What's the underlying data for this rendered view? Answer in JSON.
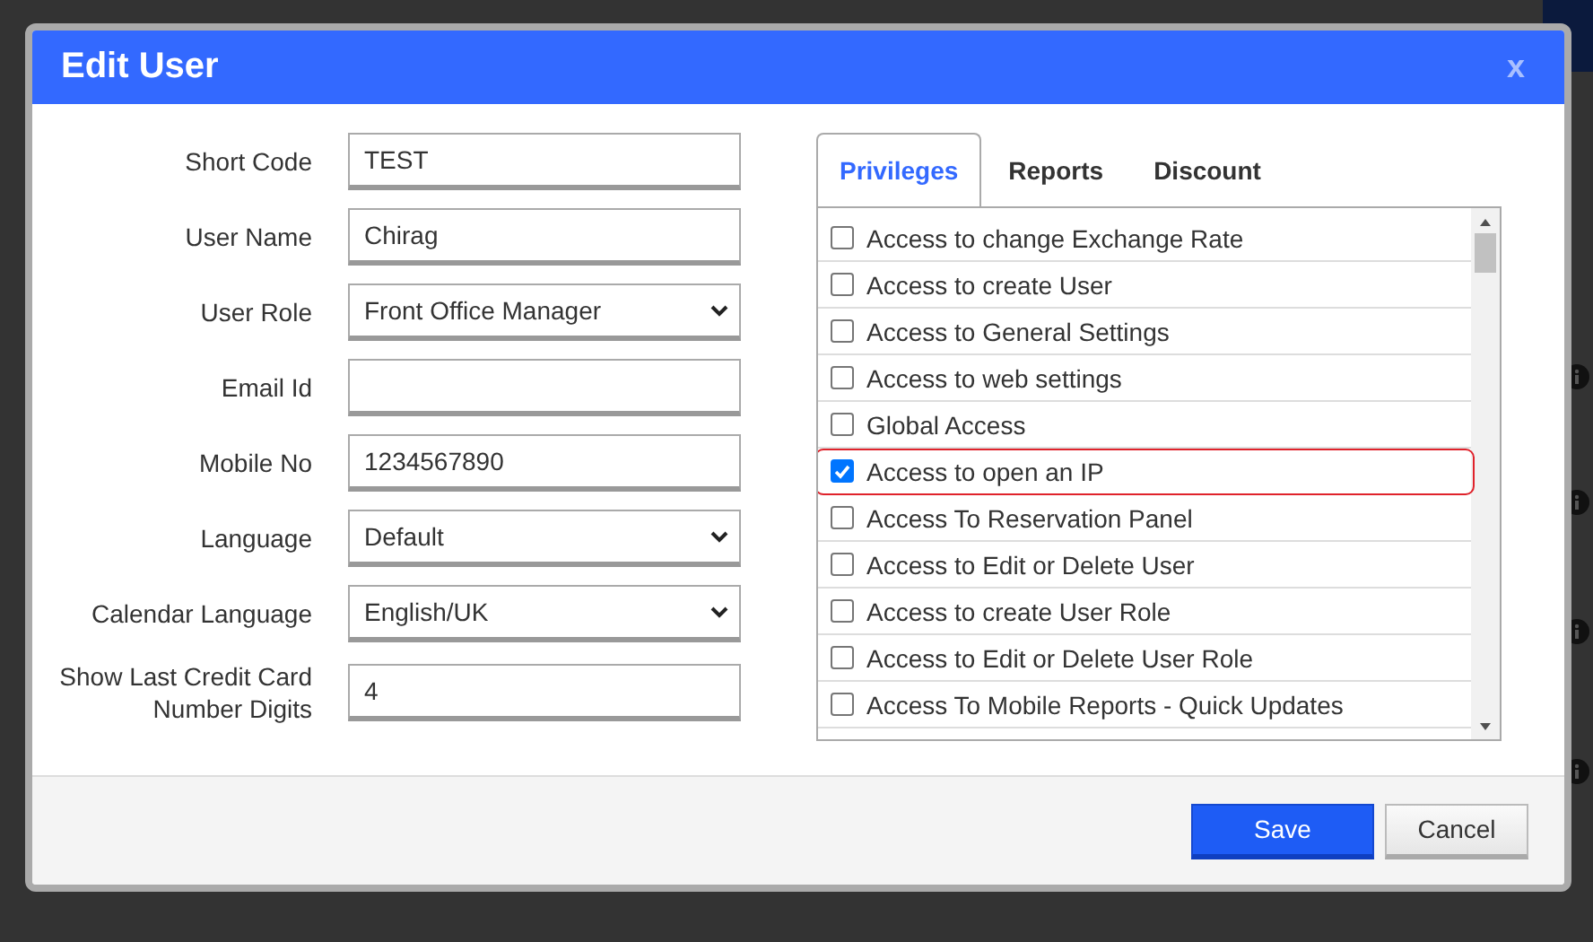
{
  "dialog": {
    "title": "Edit User",
    "close": "x",
    "fields": [
      {
        "label": "Short Code",
        "kind": "text",
        "value": "TEST"
      },
      {
        "label": "User Name",
        "kind": "text",
        "value": "Chirag"
      },
      {
        "label": "User Role",
        "kind": "select",
        "value": "Front Office Manager"
      },
      {
        "label": "Email Id",
        "kind": "text"
      },
      {
        "label": "Mobile No",
        "kind": "text",
        "value": "1234567890"
      },
      {
        "label": "Language",
        "kind": "select",
        "value": "Default"
      },
      {
        "label": "Calendar Language",
        "kind": "select",
        "value": "English/UK"
      },
      {
        "label": "Show Last Credit Card Number Digits",
        "kind": "text",
        "value": "4"
      }
    ],
    "tabs": [
      {
        "label": "Privileges",
        "selected": true
      },
      {
        "label": "Reports",
        "selected": false
      },
      {
        "label": "Discount",
        "selected": false
      }
    ],
    "privileges": [
      {
        "label": "Access to change Exchange Rate",
        "checked": false,
        "highlighted": false
      },
      {
        "label": "Access to create User",
        "checked": false,
        "highlighted": false
      },
      {
        "label": "Access to General Settings",
        "checked": false,
        "highlighted": false
      },
      {
        "label": "Access to web settings",
        "checked": false,
        "highlighted": false
      },
      {
        "label": "Global Access",
        "checked": false,
        "highlighted": false
      },
      {
        "label": "Access to open an IP",
        "checked": true,
        "highlighted": true
      },
      {
        "label": "Access To Reservation Panel",
        "checked": false,
        "highlighted": false
      },
      {
        "label": "Access to Edit or Delete User",
        "checked": false,
        "highlighted": false
      },
      {
        "label": "Access to create User Role",
        "checked": false,
        "highlighted": false
      },
      {
        "label": "Access to Edit or Delete User Role",
        "checked": false,
        "highlighted": false
      },
      {
        "label": "Access To Mobile Reports - Quick Updates",
        "checked": false,
        "highlighted": false
      }
    ],
    "buttons": [
      {
        "label": "Save",
        "kind": "primary"
      },
      {
        "label": "Cancel",
        "kind": "secondary"
      }
    ]
  }
}
